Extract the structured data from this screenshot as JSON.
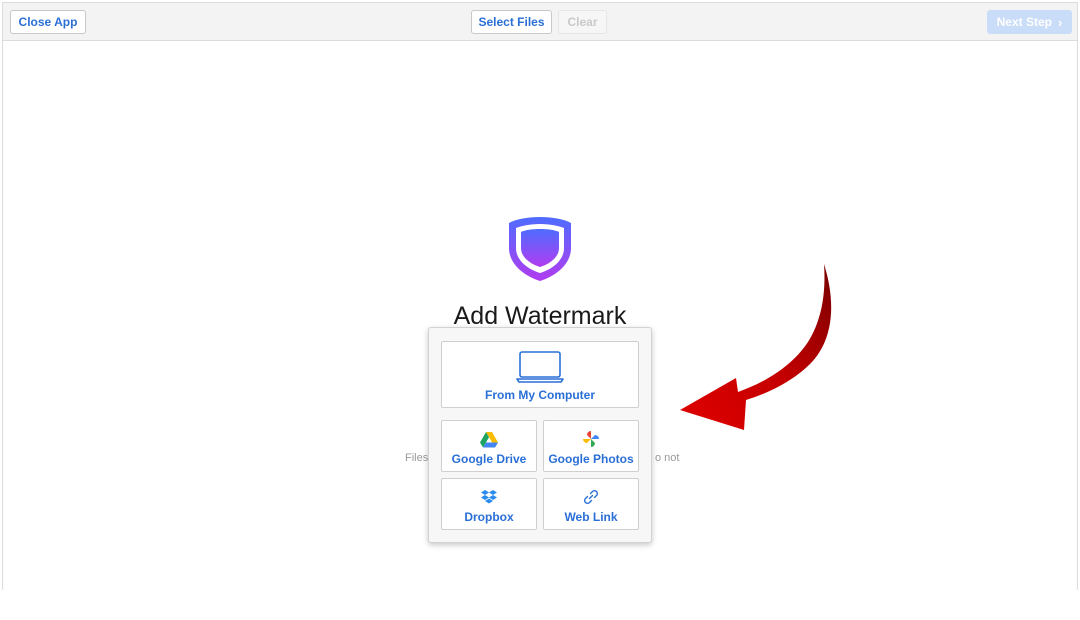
{
  "toolbar": {
    "close_label": "Close App",
    "select_files_label": "Select Files",
    "clear_label": "Clear",
    "next_step_label": "Next Step",
    "next_step_chevron": "›"
  },
  "main": {
    "title": "Add Watermark",
    "hint_left": "Files",
    "hint_right": "o not"
  },
  "picker": {
    "computer_label": "From My Computer",
    "gdrive_label": "Google Drive",
    "gphotos_label": "Google Photos",
    "dropbox_label": "Dropbox",
    "weblink_label": "Web Link"
  },
  "colors": {
    "accent": "#2a6fd6",
    "shield_top": "#4f6cff",
    "shield_bottom": "#b13cf0",
    "arrow": "#c00000"
  },
  "icons": {
    "hero": "shield-icon",
    "computer": "laptop-icon",
    "gdrive": "google-drive-icon",
    "gphotos": "google-photos-icon",
    "dropbox": "dropbox-icon",
    "weblink": "link-icon",
    "pointer": "curved-arrow-icon"
  }
}
